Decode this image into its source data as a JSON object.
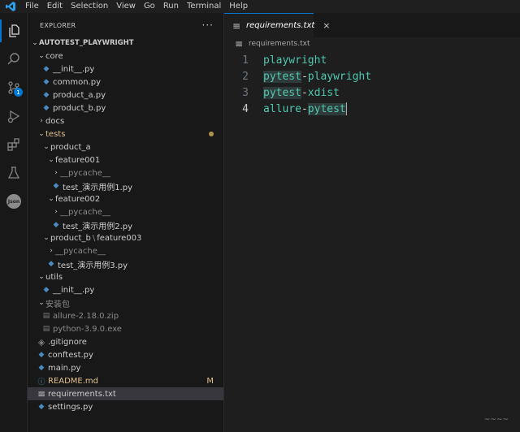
{
  "menu": [
    "File",
    "Edit",
    "Selection",
    "View",
    "Go",
    "Run",
    "Terminal",
    "Help"
  ],
  "activity": {
    "scm_badge": "1",
    "json_label": "Json"
  },
  "explorer": {
    "title": "EXPLORER",
    "more": "···",
    "root": "AUTOTEST_PLAYWRIGHT",
    "items": [
      "core",
      "__init__.py",
      "common.py",
      "product_a.py",
      "product_b.py",
      "docs",
      "tests",
      "product_a",
      "feature001",
      "__pycache__",
      "test_演示用例1.py",
      "feature002",
      "__pycache__",
      "test_演示用例2.py",
      "product_b",
      "feature003",
      "__pycache__",
      "test_演示用例3.py",
      "utils",
      "__init__.py",
      "安装包",
      "allure-2.18.0.zip",
      "python-3.9.0.exe",
      ".gitignore",
      "conftest.py",
      "main.py",
      "README.md",
      "requirements.txt",
      "settings.py"
    ],
    "separator": "\\",
    "readme_status": "M"
  },
  "tab": {
    "label": "requirements.txt",
    "close": "×"
  },
  "breadcrumb": {
    "file": "requirements.txt"
  },
  "editor": {
    "line_numbers": [
      "1",
      "2",
      "3",
      "4"
    ],
    "l1": "playwright",
    "l2a": "pytest",
    "l2b": "-",
    "l2c": "playwright",
    "l3a": "pytest",
    "l3b": "-",
    "l3c": "xdist",
    "l4a": "allure",
    "l4b": "-",
    "l4c": "pytest"
  },
  "watermark": "~~~~"
}
